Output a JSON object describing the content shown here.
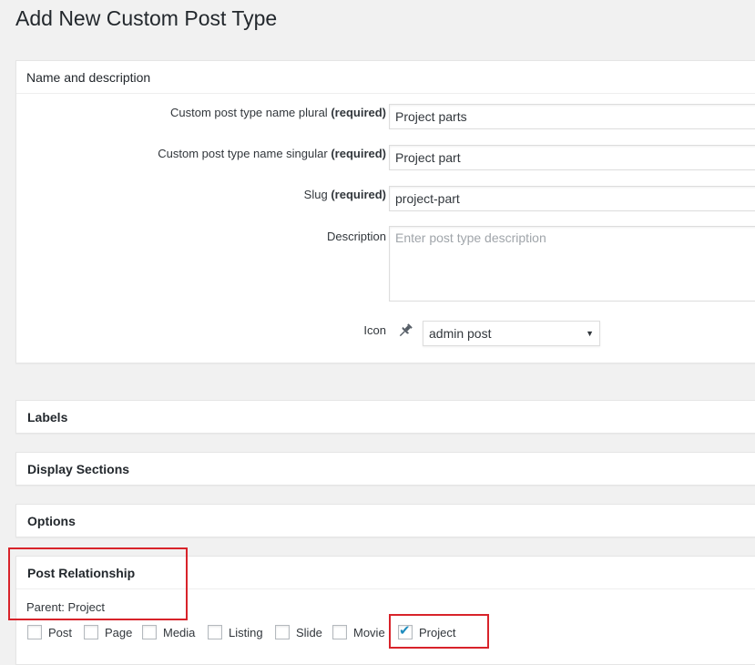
{
  "page": {
    "title": "Add New Custom Post Type"
  },
  "name_box": {
    "title": "Name and description",
    "plural_label": "Custom post type name plural",
    "plural_required": "(required)",
    "plural_value": "Project parts",
    "singular_label": "Custom post type name singular",
    "singular_required": "(required)",
    "singular_value": "Project part",
    "slug_label": "Slug",
    "slug_required": "(required)",
    "slug_value": "project-part",
    "description_label": "Description",
    "description_placeholder": "Enter post type description",
    "icon_label": "Icon",
    "icon_name": "pin-icon",
    "icon_select_value": "admin post"
  },
  "labels_box": {
    "title": "Labels"
  },
  "display_box": {
    "title": "Display Sections"
  },
  "options_box": {
    "title": "Options"
  },
  "relationship_box": {
    "title": "Post Relationship",
    "parent_text": "Parent: Project",
    "post_types": [
      {
        "label": "Post",
        "checked": false
      },
      {
        "label": "Page",
        "checked": false
      },
      {
        "label": "Media",
        "checked": false
      },
      {
        "label": "Listing",
        "checked": false
      },
      {
        "label": "Slide",
        "checked": false
      },
      {
        "label": "Movie",
        "checked": false
      },
      {
        "label": "Project",
        "checked": true
      }
    ]
  },
  "colors": {
    "highlight": "#d8232a",
    "checkmark": "#1e8cbe",
    "background": "#f1f1f1"
  }
}
